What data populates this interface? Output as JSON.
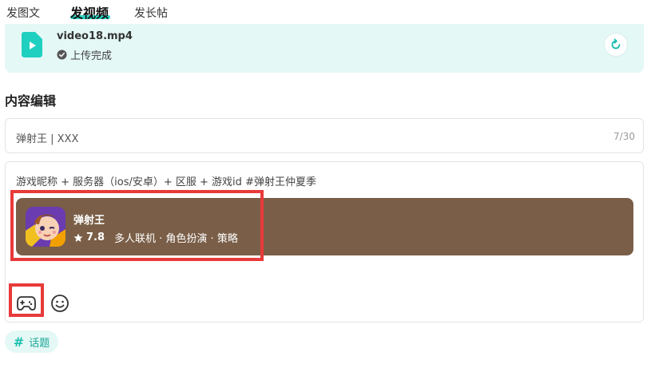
{
  "tabs": [
    {
      "label": "发图文",
      "active": false
    },
    {
      "label": "发视频",
      "active": true
    },
    {
      "label": "发长帖",
      "active": false
    }
  ],
  "upload": {
    "file_name": "video18.mp4",
    "status": "上传完成",
    "icon": "video-file-icon",
    "retry_icon": "refresh-icon"
  },
  "section": {
    "title": "内容编辑"
  },
  "title_input": {
    "value": "弹射王 |  XXX",
    "count": "7/30"
  },
  "editor": {
    "text_prefix": "游戏昵称 + 服务器（ios/安卓）+ 区服 + 游戏id ",
    "hashtag": "#弹射王仲夏季",
    "game_card": {
      "name": "弹射王",
      "rating": "7.8",
      "tags": "多人联机 · 角色扮演 · 策略",
      "icon": "game-cover-icon",
      "background": "#7a5e47"
    },
    "toolbar": {
      "game_icon": "gamepad-icon",
      "emoji_icon": "emoji-icon"
    }
  },
  "topic": {
    "hash": "#",
    "label": "话题"
  },
  "colors": {
    "accent": "#2cd6c4",
    "highlight": "#e83a3a",
    "upload_bg": "#e4f8f6"
  }
}
